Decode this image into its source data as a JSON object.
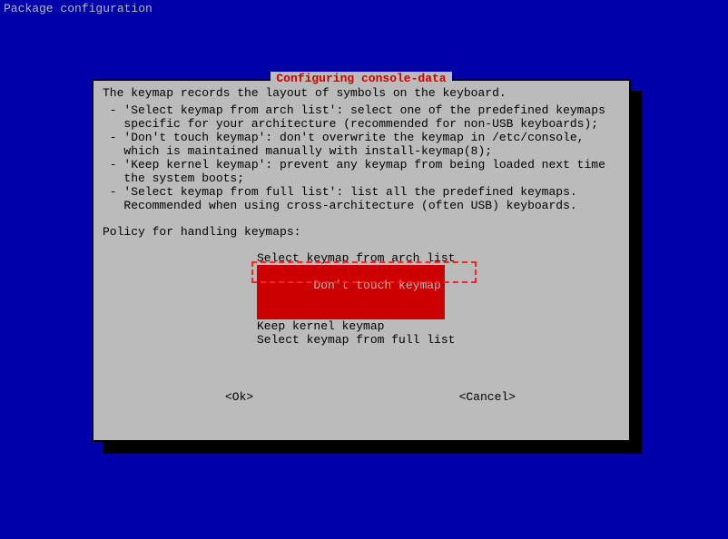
{
  "header": {
    "title": "Package configuration"
  },
  "dialog": {
    "title": "Configuring console-data",
    "description": "The keymap records the layout of symbols on the keyboard.",
    "bullets": {
      "b1l1": " - 'Select keymap from arch list': select one of the predefined keymaps",
      "b1l2": "   specific for your architecture (recommended for non-USB keyboards);",
      "b2l1": " - 'Don't touch keymap': don't overwrite the keymap in /etc/console,",
      "b2l2": "   which is maintained manually with install-keymap(8);",
      "b3l1": " - 'Keep kernel keymap': prevent any keymap from being loaded next time",
      "b3l2": "   the system boots;",
      "b4l1": " - 'Select keymap from full list': list all the predefined keymaps.",
      "b4l2": "   Recommended when using cross-architecture (often USB) keyboards."
    },
    "prompt": "Policy for handling keymaps:",
    "options": {
      "opt1": "Select keymap from arch list",
      "opt2": "Don't touch keymap",
      "opt3": "Keep kernel keymap",
      "opt4": "Select keymap from full list"
    },
    "buttons": {
      "ok": "<Ok>",
      "cancel": "<Cancel>"
    }
  }
}
